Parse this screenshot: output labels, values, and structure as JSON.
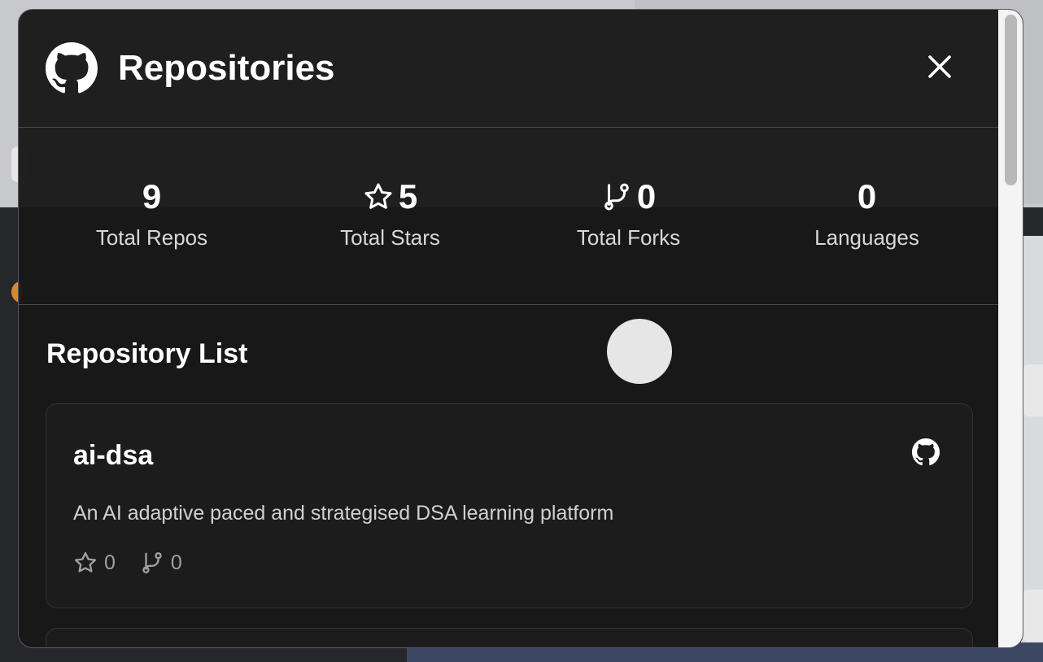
{
  "modal": {
    "title": "Repositories"
  },
  "stats": [
    {
      "value": "9",
      "label": "Total Repos",
      "icon": "none"
    },
    {
      "value": "5",
      "label": "Total Stars",
      "icon": "star-icon"
    },
    {
      "value": "0",
      "label": "Total Forks",
      "icon": "fork-icon"
    },
    {
      "value": "0",
      "label": "Languages",
      "icon": "none"
    }
  ],
  "list": {
    "title": "Repository List"
  },
  "repos": [
    {
      "name": "ai-dsa",
      "description": "An AI adaptive paced and strategised DSA learning platform",
      "stars": "0",
      "forks": "0"
    }
  ],
  "colors": {
    "modal_bg": "#181818",
    "text_primary": "#ffffff",
    "text_secondary": "#d8d8d8",
    "meta_text": "#a0a0a0"
  }
}
